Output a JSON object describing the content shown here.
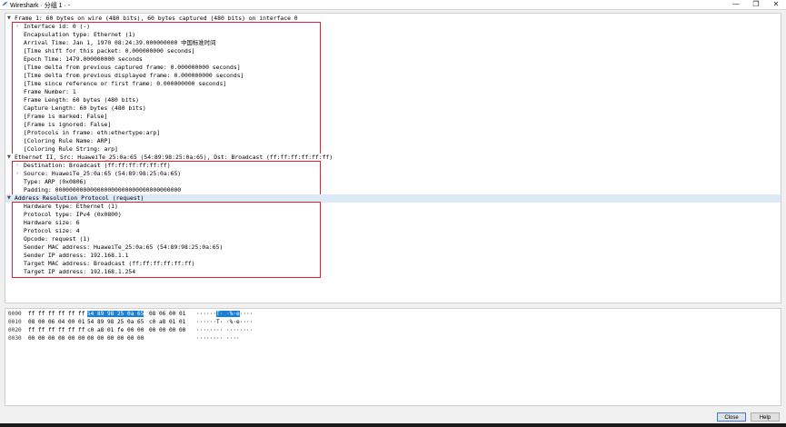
{
  "window": {
    "title": "Wireshark · 分组 1 · -",
    "minimize_glyph": "—",
    "maximize_glyph": "❐",
    "close_glyph": "✕"
  },
  "tree": {
    "frame_header": "Frame 1: 60 bytes on wire (480 bits), 60 bytes captured (480 bits) on interface 0",
    "frame_items": [
      "Interface id: 0 (-)",
      "Encapsulation type: Ethernet (1)",
      "Arrival Time: Jan  1, 1970 08:24:39.000000000 中国标准时间",
      "[Time shift for this packet: 0.000000000 seconds]",
      "Epoch Time: 1479.000000000 seconds",
      "[Time delta from previous captured frame: 0.000000000 seconds]",
      "[Time delta from previous displayed frame: 0.000000000 seconds]",
      "[Time since reference or first frame: 0.000000000 seconds]",
      "Frame Number: 1",
      "Frame Length: 60 bytes (480 bits)",
      "Capture Length: 60 bytes (480 bits)",
      "[Frame is marked: False]",
      "[Frame is ignored: False]",
      "[Protocols in frame: eth:ethertype:arp]",
      "[Coloring Rule Name: ARP]",
      "[Coloring Rule String: arp]"
    ],
    "eth_header": "Ethernet II, Src: HuaweiTe_25:0a:65 (54:89:98:25:0a:65), Dst: Broadcast (ff:ff:ff:ff:ff:ff)",
    "eth_items": [
      "Destination: Broadcast (ff:ff:ff:ff:ff:ff)",
      "Source: HuaweiTe_25:0a:65 (54:89:98:25:0a:65)",
      "Type: ARP (0x0806)",
      "Padding: 000000000000000000000000000000000000"
    ],
    "arp_header": "Address Resolution Protocol (request)",
    "arp_items": [
      "Hardware type: Ethernet (1)",
      "Protocol type: IPv4 (0x0800)",
      "Hardware size: 6",
      "Protocol size: 4",
      "Opcode: request (1)",
      "Sender MAC address: HuaweiTe_25:0a:65 (54:89:98:25:0a:65)",
      "Sender IP address: 192.168.1.1",
      "Target MAC address: Broadcast (ff:ff:ff:ff:ff:ff)",
      "Target IP address: 192.168.1.254"
    ]
  },
  "hex": [
    {
      "offset": "0000",
      "b1": "ff ff ff ff ff ff",
      "b2_pre": "",
      "b2_hl": "54 89  98 25 0a 65",
      "b3": "08 06 00 01",
      "ascii_pre": "······",
      "ascii_hl": "T· ·%·e",
      "ascii_post": "····"
    },
    {
      "offset": "0010",
      "b1": "08 00 06 04 00 01",
      "b2_pre": "54 89  98 25 0a 65",
      "b2_hl": "",
      "b3": "c0 a8 01 01",
      "ascii_pre": "······T· ·%·e····",
      "ascii_hl": "",
      "ascii_post": ""
    },
    {
      "offset": "0020",
      "b1": "ff ff ff ff ff ff",
      "b2_pre": "c0 a8  01 fe 00 00",
      "b2_hl": "",
      "b3": "00 00 00 00",
      "ascii_pre": "········ ········",
      "ascii_hl": "",
      "ascii_post": ""
    },
    {
      "offset": "0030",
      "b1": "00 00 00 00 00 00",
      "b2_pre": "00 00  00 00 00 00",
      "b2_hl": "",
      "b3": "",
      "ascii_pre": "········ ····",
      "ascii_hl": "",
      "ascii_post": ""
    }
  ],
  "buttons": {
    "close": "Close",
    "help": "Help"
  },
  "colors": {
    "highlight_box": "#e0202a",
    "selection_bg": "#dce9f7",
    "hex_highlight": "#1a7fd6"
  }
}
